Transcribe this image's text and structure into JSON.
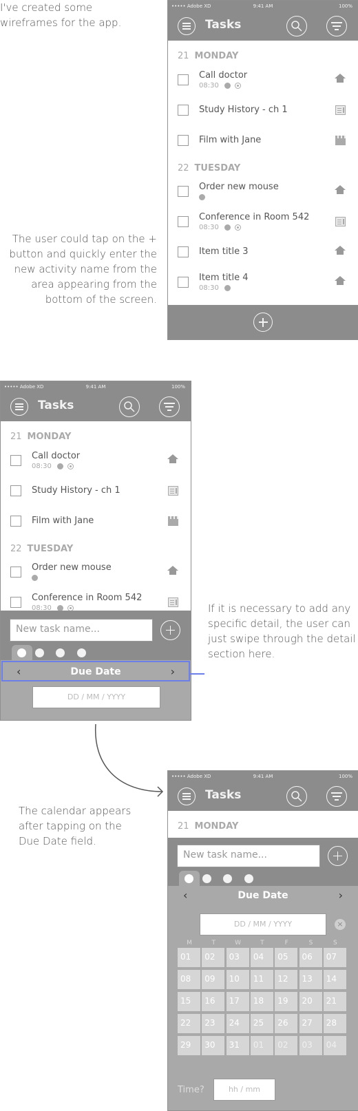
{
  "notes": {
    "intro": "I've created some wireframes for the app.",
    "plus_tip": "The user could tap on the + button and quickly enter the new activity name from the area appearing from the bottom of the screen.",
    "swipe_tip": "If it is necessary to add any specific detail, the user can just swipe through the detail section here.",
    "calendar_tip": "The calendar appears after tapping on the Due Date field."
  },
  "status": {
    "carrier": "••••• Adobe XD",
    "time": "9:41 AM",
    "battery": "100%"
  },
  "app": {
    "title": "Tasks"
  },
  "days": [
    {
      "num": "21",
      "name": "MONDAY"
    },
    {
      "num": "22",
      "name": "TUESDAY"
    }
  ],
  "tasks": [
    {
      "title": "Call doctor",
      "time": "08:30",
      "icon": "home-icon"
    },
    {
      "title": "Study History - ch 1",
      "time": "",
      "icon": "document-icon"
    },
    {
      "title": "Film with Jane",
      "time": "",
      "icon": "clapperboard-icon"
    },
    {
      "title": "Order new mouse",
      "time": "",
      "icon": "home-icon"
    },
    {
      "title": "Conference in Room 542",
      "time": "08:30",
      "icon": "document-icon"
    },
    {
      "title": "Item title 3",
      "time": "",
      "icon": "home-icon"
    },
    {
      "title": "Item title 4",
      "time": "08:30",
      "icon": "home-icon"
    }
  ],
  "quick_add": {
    "placeholder": "New task name...",
    "due_label": "Due Date",
    "date_placeholder": "DD / MM / YYYY",
    "time_label": "Time?",
    "time_placeholder": "hh / mm"
  },
  "calendar": {
    "weekdays": [
      "M",
      "T",
      "W",
      "T",
      "F",
      "S",
      "S"
    ],
    "days": [
      "01",
      "02",
      "03",
      "04",
      "05",
      "06",
      "07",
      "08",
      "09",
      "10",
      "11",
      "12",
      "13",
      "14",
      "15",
      "16",
      "17",
      "18",
      "19",
      "20",
      "21",
      "22",
      "23",
      "24",
      "25",
      "26",
      "27",
      "28",
      "29",
      "30",
      "31",
      "01",
      "02",
      "03",
      "04"
    ],
    "next_month_start_index": 31
  },
  "colors": {
    "bar": "#8c8c8c",
    "highlight": "#6c7fe8"
  }
}
